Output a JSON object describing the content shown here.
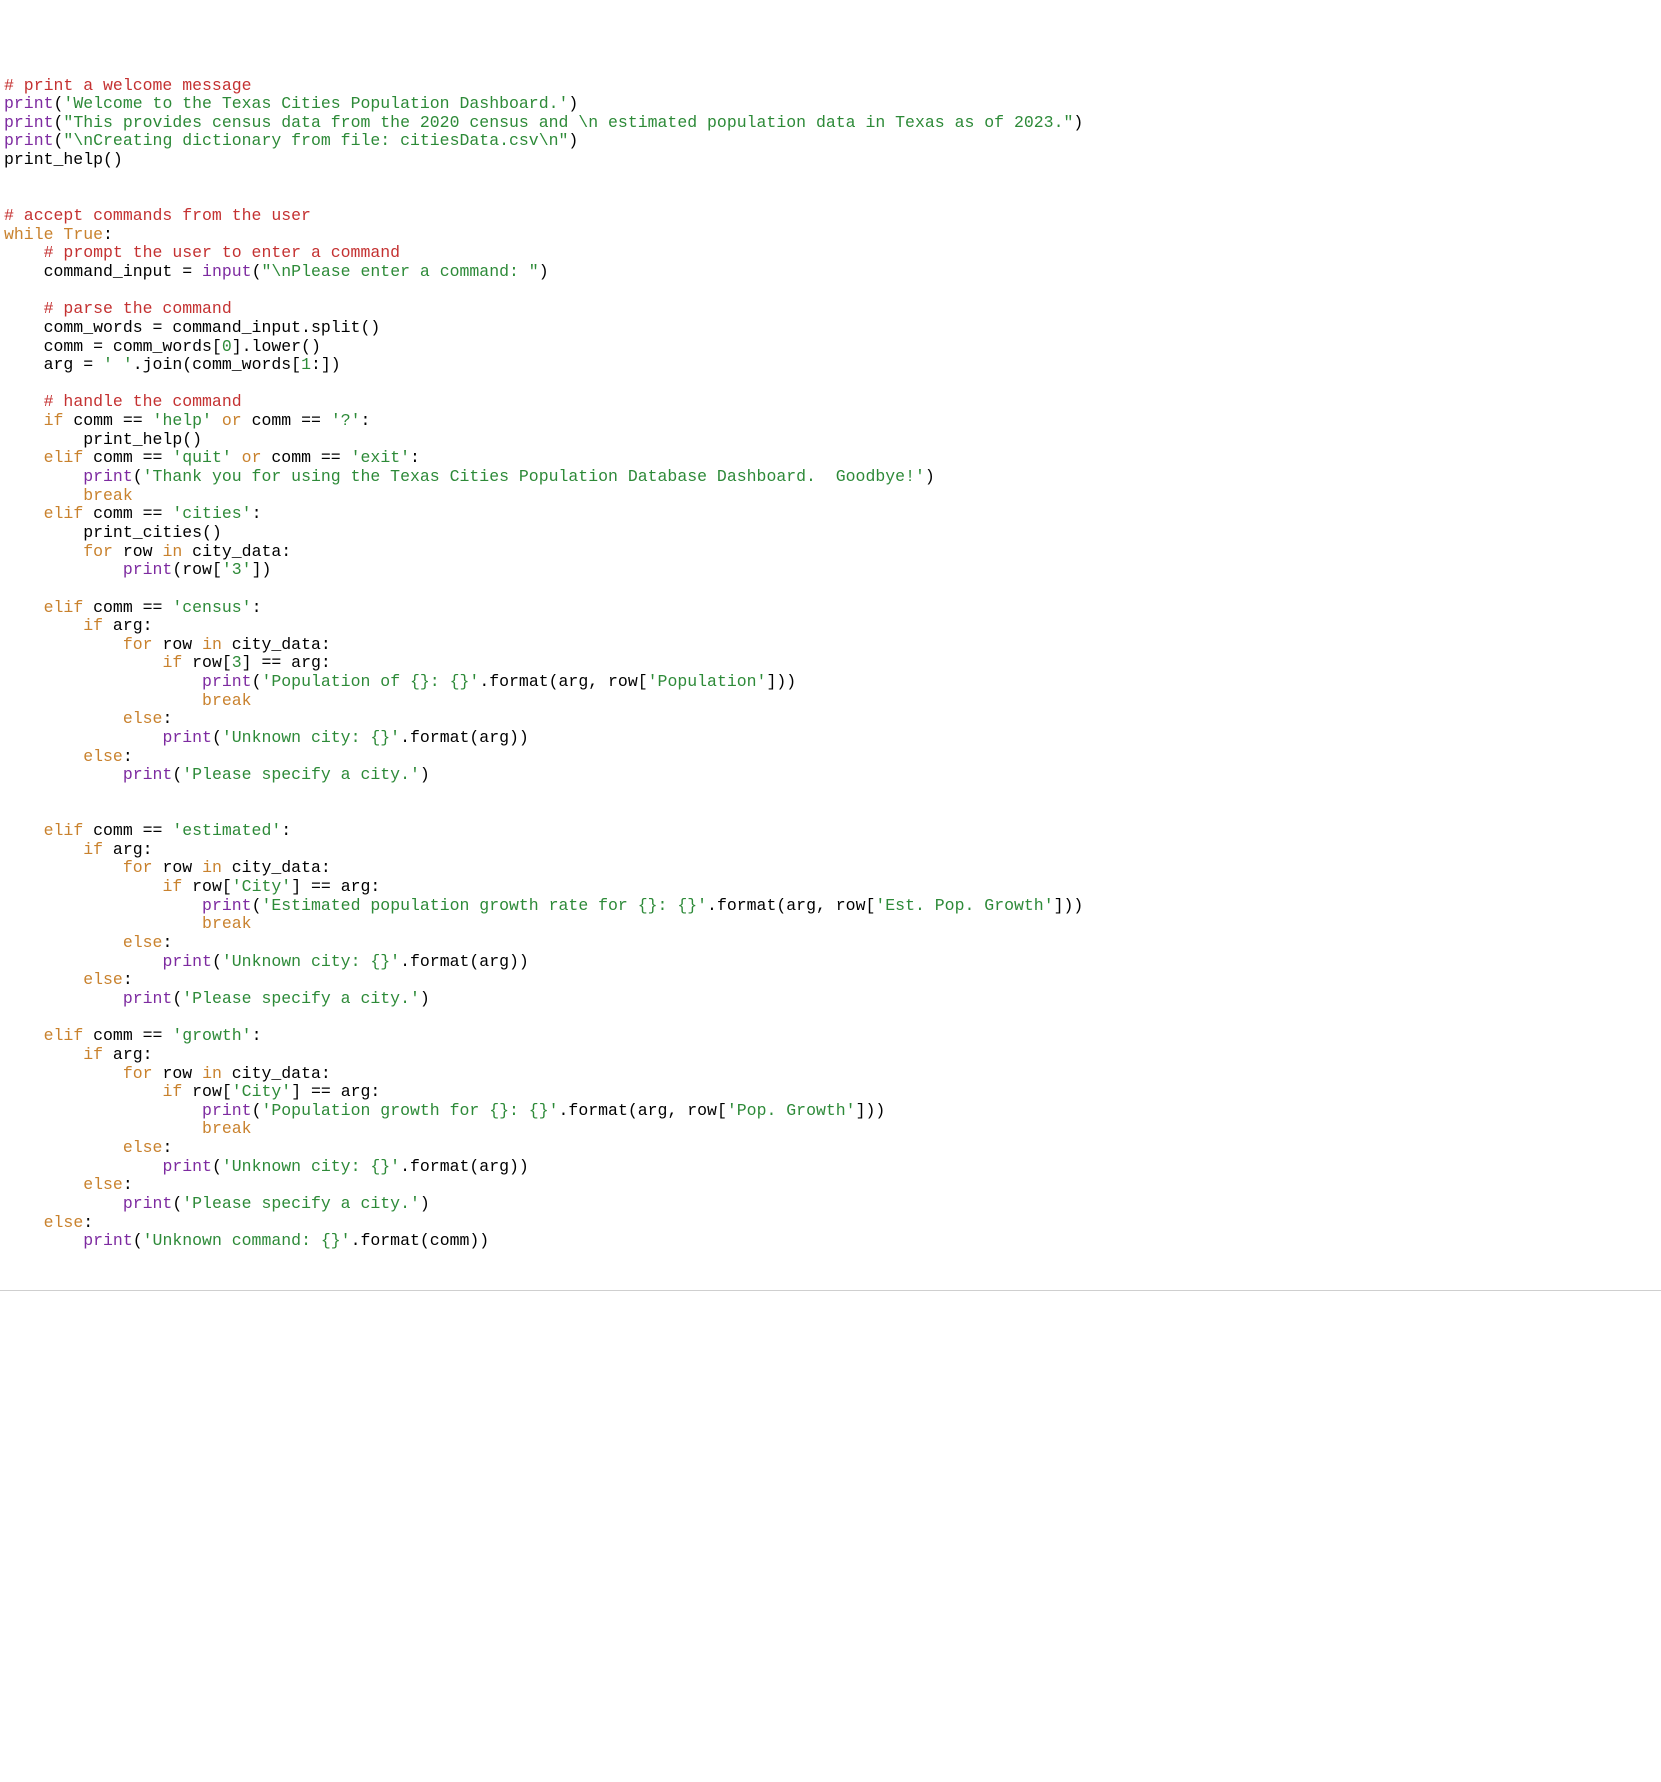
{
  "code": {
    "tokens": [
      {
        "t": "# print a welcome message",
        "c": "c-comment"
      },
      "\n",
      {
        "t": "print",
        "c": "c-builtin"
      },
      {
        "t": "(",
        "c": "c-default"
      },
      {
        "t": "'Welcome to the Texas Cities Population Dashboard.'",
        "c": "c-str"
      },
      {
        "t": ")",
        "c": "c-default"
      },
      "\n",
      {
        "t": "print",
        "c": "c-builtin"
      },
      {
        "t": "(",
        "c": "c-default"
      },
      {
        "t": "\"This provides census data from the 2020 census and \\n estimated population data in Texas as of 2023.\"",
        "c": "c-str"
      },
      {
        "t": ")",
        "c": "c-default"
      },
      "\n",
      {
        "t": "print",
        "c": "c-builtin"
      },
      {
        "t": "(",
        "c": "c-default"
      },
      {
        "t": "\"\\nCreating dictionary from file: citiesData.csv\\n\"",
        "c": "c-str"
      },
      {
        "t": ")",
        "c": "c-default"
      },
      "\n",
      {
        "t": "print_help()",
        "c": "c-default"
      },
      "\n",
      "\n",
      "\n",
      {
        "t": "# accept commands from the user",
        "c": "c-comment"
      },
      "\n",
      {
        "t": "while",
        "c": "c-kw"
      },
      {
        "t": " ",
        "c": "c-default"
      },
      {
        "t": "True",
        "c": "c-kw"
      },
      {
        "t": ":",
        "c": "c-default"
      },
      "\n",
      {
        "t": "    ",
        "c": "c-default"
      },
      {
        "t": "# prompt the user to enter a command",
        "c": "c-comment"
      },
      "\n",
      {
        "t": "    command_input = ",
        "c": "c-default"
      },
      {
        "t": "input",
        "c": "c-builtin"
      },
      {
        "t": "(",
        "c": "c-default"
      },
      {
        "t": "\"\\nPlease enter a command: \"",
        "c": "c-str"
      },
      {
        "t": ")",
        "c": "c-default"
      },
      "\n",
      "\n",
      {
        "t": "    ",
        "c": "c-default"
      },
      {
        "t": "# parse the command",
        "c": "c-comment"
      },
      "\n",
      {
        "t": "    comm_words = command_input.split()",
        "c": "c-default"
      },
      "\n",
      {
        "t": "    comm = comm_words[",
        "c": "c-default"
      },
      {
        "t": "0",
        "c": "c-str"
      },
      {
        "t": "].lower()",
        "c": "c-default"
      },
      "\n",
      {
        "t": "    arg = ",
        "c": "c-default"
      },
      {
        "t": "' '",
        "c": "c-str"
      },
      {
        "t": ".join(comm_words[",
        "c": "c-default"
      },
      {
        "t": "1",
        "c": "c-str"
      },
      {
        "t": ":])",
        "c": "c-default"
      },
      "\n",
      "\n",
      {
        "t": "    ",
        "c": "c-default"
      },
      {
        "t": "# handle the command",
        "c": "c-comment"
      },
      "\n",
      {
        "t": "    ",
        "c": "c-default"
      },
      {
        "t": "if",
        "c": "c-kw"
      },
      {
        "t": " comm == ",
        "c": "c-default"
      },
      {
        "t": "'help'",
        "c": "c-str"
      },
      {
        "t": " ",
        "c": "c-default"
      },
      {
        "t": "or",
        "c": "c-kw"
      },
      {
        "t": " comm == ",
        "c": "c-default"
      },
      {
        "t": "'?'",
        "c": "c-str"
      },
      {
        "t": ":",
        "c": "c-default"
      },
      "\n",
      {
        "t": "        print_help()",
        "c": "c-default"
      },
      "\n",
      {
        "t": "    ",
        "c": "c-default"
      },
      {
        "t": "elif",
        "c": "c-kw"
      },
      {
        "t": " comm == ",
        "c": "c-default"
      },
      {
        "t": "'quit'",
        "c": "c-str"
      },
      {
        "t": " ",
        "c": "c-default"
      },
      {
        "t": "or",
        "c": "c-kw"
      },
      {
        "t": " comm == ",
        "c": "c-default"
      },
      {
        "t": "'exit'",
        "c": "c-str"
      },
      {
        "t": ":",
        "c": "c-default"
      },
      "\n",
      {
        "t": "        ",
        "c": "c-default"
      },
      {
        "t": "print",
        "c": "c-builtin"
      },
      {
        "t": "(",
        "c": "c-default"
      },
      {
        "t": "'Thank you for using the Texas Cities Population Database Dashboard.  Goodbye!'",
        "c": "c-str"
      },
      {
        "t": ")",
        "c": "c-default"
      },
      "\n",
      {
        "t": "        ",
        "c": "c-default"
      },
      {
        "t": "break",
        "c": "c-kw"
      },
      "\n",
      {
        "t": "    ",
        "c": "c-default"
      },
      {
        "t": "elif",
        "c": "c-kw"
      },
      {
        "t": " comm == ",
        "c": "c-default"
      },
      {
        "t": "'cities'",
        "c": "c-str"
      },
      {
        "t": ":",
        "c": "c-default"
      },
      "\n",
      {
        "t": "        print_cities()",
        "c": "c-default"
      },
      "\n",
      {
        "t": "        ",
        "c": "c-default"
      },
      {
        "t": "for",
        "c": "c-kw"
      },
      {
        "t": " row ",
        "c": "c-default"
      },
      {
        "t": "in",
        "c": "c-kw"
      },
      {
        "t": " city_data:",
        "c": "c-default"
      },
      "\n",
      {
        "t": "            ",
        "c": "c-default"
      },
      {
        "t": "print",
        "c": "c-builtin"
      },
      {
        "t": "(row[",
        "c": "c-default"
      },
      {
        "t": "'3'",
        "c": "c-str"
      },
      {
        "t": "])",
        "c": "c-default"
      },
      "\n",
      "\n",
      {
        "t": "    ",
        "c": "c-default"
      },
      {
        "t": "elif",
        "c": "c-kw"
      },
      {
        "t": " comm == ",
        "c": "c-default"
      },
      {
        "t": "'census'",
        "c": "c-str"
      },
      {
        "t": ":",
        "c": "c-default"
      },
      "\n",
      {
        "t": "        ",
        "c": "c-default"
      },
      {
        "t": "if",
        "c": "c-kw"
      },
      {
        "t": " arg:",
        "c": "c-default"
      },
      "\n",
      {
        "t": "            ",
        "c": "c-default"
      },
      {
        "t": "for",
        "c": "c-kw"
      },
      {
        "t": " row ",
        "c": "c-default"
      },
      {
        "t": "in",
        "c": "c-kw"
      },
      {
        "t": " city_data:",
        "c": "c-default"
      },
      "\n",
      {
        "t": "                ",
        "c": "c-default"
      },
      {
        "t": "if",
        "c": "c-kw"
      },
      {
        "t": " row[",
        "c": "c-default"
      },
      {
        "t": "3",
        "c": "c-str"
      },
      {
        "t": "] == arg:",
        "c": "c-default"
      },
      "\n",
      {
        "t": "                    ",
        "c": "c-default"
      },
      {
        "t": "print",
        "c": "c-builtin"
      },
      {
        "t": "(",
        "c": "c-default"
      },
      {
        "t": "'Population of {}: {}'",
        "c": "c-str"
      },
      {
        "t": ".format(arg, row[",
        "c": "c-default"
      },
      {
        "t": "'Population'",
        "c": "c-str"
      },
      {
        "t": "]))",
        "c": "c-default"
      },
      "\n",
      {
        "t": "                    ",
        "c": "c-default"
      },
      {
        "t": "break",
        "c": "c-kw"
      },
      "\n",
      {
        "t": "            ",
        "c": "c-default"
      },
      {
        "t": "else",
        "c": "c-kw"
      },
      {
        "t": ":",
        "c": "c-default"
      },
      "\n",
      {
        "t": "                ",
        "c": "c-default"
      },
      {
        "t": "print",
        "c": "c-builtin"
      },
      {
        "t": "(",
        "c": "c-default"
      },
      {
        "t": "'Unknown city: {}'",
        "c": "c-str"
      },
      {
        "t": ".format(arg))",
        "c": "c-default"
      },
      "\n",
      {
        "t": "        ",
        "c": "c-default"
      },
      {
        "t": "else",
        "c": "c-kw"
      },
      {
        "t": ":",
        "c": "c-default"
      },
      "\n",
      {
        "t": "            ",
        "c": "c-default"
      },
      {
        "t": "print",
        "c": "c-builtin"
      },
      {
        "t": "(",
        "c": "c-default"
      },
      {
        "t": "'Please specify a city.'",
        "c": "c-str"
      },
      {
        "t": ")",
        "c": "c-default"
      },
      "\n",
      "\n",
      "\n",
      {
        "t": "    ",
        "c": "c-default"
      },
      {
        "t": "elif",
        "c": "c-kw"
      },
      {
        "t": " comm == ",
        "c": "c-default"
      },
      {
        "t": "'estimated'",
        "c": "c-str"
      },
      {
        "t": ":",
        "c": "c-default"
      },
      "\n",
      {
        "t": "        ",
        "c": "c-default"
      },
      {
        "t": "if",
        "c": "c-kw"
      },
      {
        "t": " arg:",
        "c": "c-default"
      },
      "\n",
      {
        "t": "            ",
        "c": "c-default"
      },
      {
        "t": "for",
        "c": "c-kw"
      },
      {
        "t": " row ",
        "c": "c-default"
      },
      {
        "t": "in",
        "c": "c-kw"
      },
      {
        "t": " city_data:",
        "c": "c-default"
      },
      "\n",
      {
        "t": "                ",
        "c": "c-default"
      },
      {
        "t": "if",
        "c": "c-kw"
      },
      {
        "t": " row[",
        "c": "c-default"
      },
      {
        "t": "'City'",
        "c": "c-str"
      },
      {
        "t": "] == arg:",
        "c": "c-default"
      },
      "\n",
      {
        "t": "                    ",
        "c": "c-default"
      },
      {
        "t": "print",
        "c": "c-builtin"
      },
      {
        "t": "(",
        "c": "c-default"
      },
      {
        "t": "'Estimated population growth rate for {}: {}'",
        "c": "c-str"
      },
      {
        "t": ".format(arg, row[",
        "c": "c-default"
      },
      {
        "t": "'Est. Pop. Growth'",
        "c": "c-str"
      },
      {
        "t": "]))",
        "c": "c-default"
      },
      "\n",
      {
        "t": "                    ",
        "c": "c-default"
      },
      {
        "t": "break",
        "c": "c-kw"
      },
      "\n",
      {
        "t": "            ",
        "c": "c-default"
      },
      {
        "t": "else",
        "c": "c-kw"
      },
      {
        "t": ":",
        "c": "c-default"
      },
      "\n",
      {
        "t": "                ",
        "c": "c-default"
      },
      {
        "t": "print",
        "c": "c-builtin"
      },
      {
        "t": "(",
        "c": "c-default"
      },
      {
        "t": "'Unknown city: {}'",
        "c": "c-str"
      },
      {
        "t": ".format(arg))",
        "c": "c-default"
      },
      "\n",
      {
        "t": "        ",
        "c": "c-default"
      },
      {
        "t": "else",
        "c": "c-kw"
      },
      {
        "t": ":",
        "c": "c-default"
      },
      "\n",
      {
        "t": "            ",
        "c": "c-default"
      },
      {
        "t": "print",
        "c": "c-builtin"
      },
      {
        "t": "(",
        "c": "c-default"
      },
      {
        "t": "'Please specify a city.'",
        "c": "c-str"
      },
      {
        "t": ")",
        "c": "c-default"
      },
      "\n",
      "\n",
      {
        "t": "    ",
        "c": "c-default"
      },
      {
        "t": "elif",
        "c": "c-kw"
      },
      {
        "t": " comm == ",
        "c": "c-default"
      },
      {
        "t": "'growth'",
        "c": "c-str"
      },
      {
        "t": ":",
        "c": "c-default"
      },
      "\n",
      {
        "t": "        ",
        "c": "c-default"
      },
      {
        "t": "if",
        "c": "c-kw"
      },
      {
        "t": " arg:",
        "c": "c-default"
      },
      "\n",
      {
        "t": "            ",
        "c": "c-default"
      },
      {
        "t": "for",
        "c": "c-kw"
      },
      {
        "t": " row ",
        "c": "c-default"
      },
      {
        "t": "in",
        "c": "c-kw"
      },
      {
        "t": " city_data:",
        "c": "c-default"
      },
      "\n",
      {
        "t": "                ",
        "c": "c-default"
      },
      {
        "t": "if",
        "c": "c-kw"
      },
      {
        "t": " row[",
        "c": "c-default"
      },
      {
        "t": "'City'",
        "c": "c-str"
      },
      {
        "t": "] == arg:",
        "c": "c-default"
      },
      "\n",
      {
        "t": "                    ",
        "c": "c-default"
      },
      {
        "t": "print",
        "c": "c-builtin"
      },
      {
        "t": "(",
        "c": "c-default"
      },
      {
        "t": "'Population growth for {}: {}'",
        "c": "c-str"
      },
      {
        "t": ".format(arg, row[",
        "c": "c-default"
      },
      {
        "t": "'Pop. Growth'",
        "c": "c-str"
      },
      {
        "t": "]))",
        "c": "c-default"
      },
      "\n",
      {
        "t": "                    ",
        "c": "c-default"
      },
      {
        "t": "break",
        "c": "c-kw"
      },
      "\n",
      {
        "t": "            ",
        "c": "c-default"
      },
      {
        "t": "else",
        "c": "c-kw"
      },
      {
        "t": ":",
        "c": "c-default"
      },
      "\n",
      {
        "t": "                ",
        "c": "c-default"
      },
      {
        "t": "print",
        "c": "c-builtin"
      },
      {
        "t": "(",
        "c": "c-default"
      },
      {
        "t": "'Unknown city: {}'",
        "c": "c-str"
      },
      {
        "t": ".format(arg))",
        "c": "c-default"
      },
      "\n",
      {
        "t": "        ",
        "c": "c-default"
      },
      {
        "t": "else",
        "c": "c-kw"
      },
      {
        "t": ":",
        "c": "c-default"
      },
      "\n",
      {
        "t": "            ",
        "c": "c-default"
      },
      {
        "t": "print",
        "c": "c-builtin"
      },
      {
        "t": "(",
        "c": "c-default"
      },
      {
        "t": "'Please specify a city.'",
        "c": "c-str"
      },
      {
        "t": ")",
        "c": "c-default"
      },
      "\n",
      {
        "t": "    ",
        "c": "c-default"
      },
      {
        "t": "else",
        "c": "c-kw"
      },
      {
        "t": ":",
        "c": "c-default"
      },
      "\n",
      {
        "t": "        ",
        "c": "c-default"
      },
      {
        "t": "print",
        "c": "c-builtin"
      },
      {
        "t": "(",
        "c": "c-default"
      },
      {
        "t": "'Unknown command: {}'",
        "c": "c-str"
      },
      {
        "t": ".format(comm))",
        "c": "c-default"
      },
      "\n"
    ]
  }
}
